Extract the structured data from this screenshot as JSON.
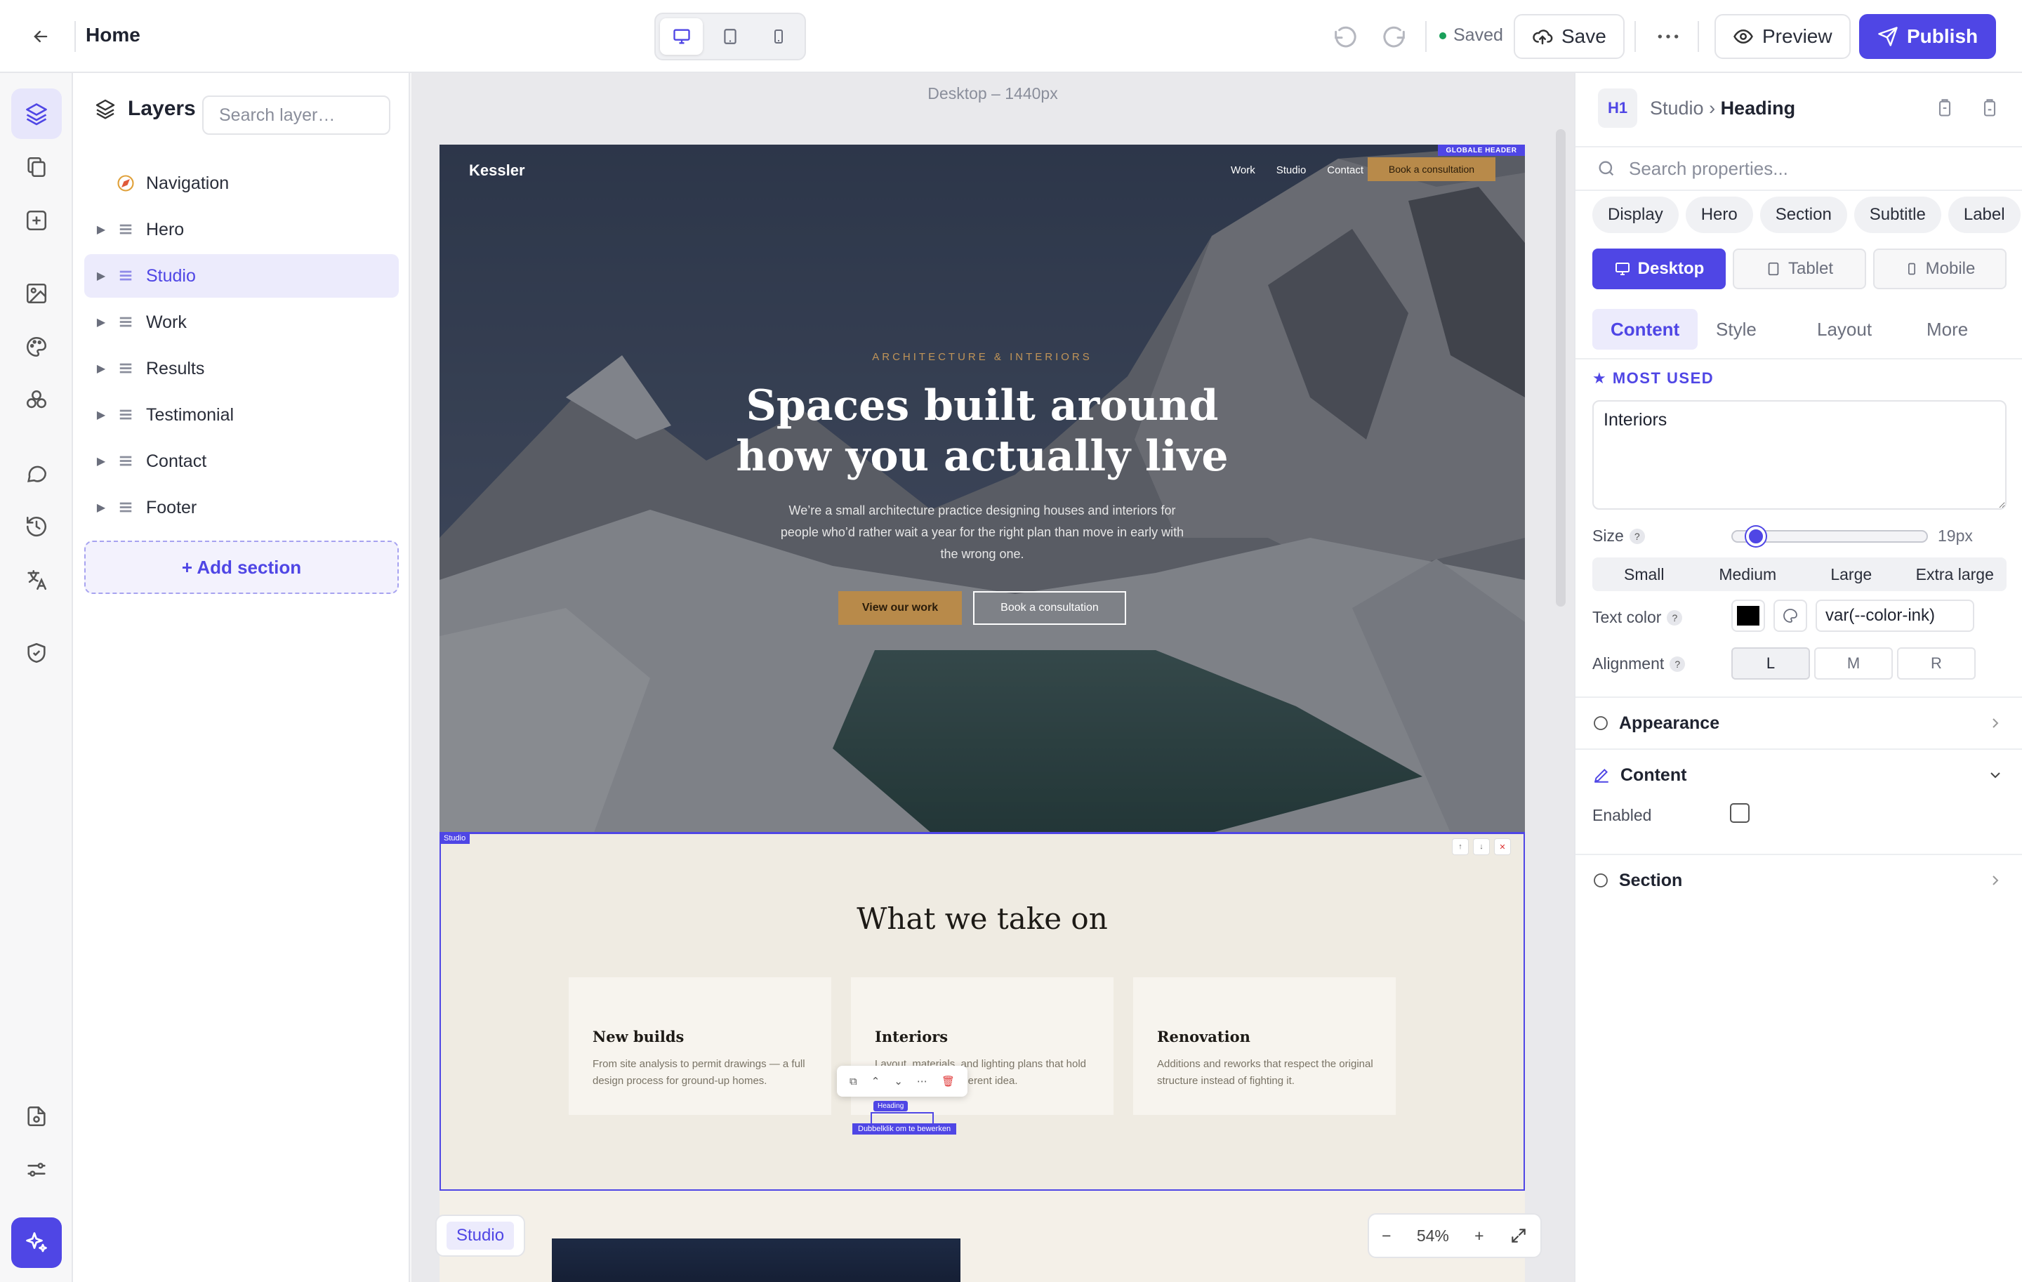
{
  "topbar": {
    "title": "Home",
    "status": "Saved",
    "save_label": "Save",
    "preview_label": "Preview",
    "publish_label": "Publish"
  },
  "layers": {
    "title": "Layers",
    "search_placeholder": "Search layer…",
    "items": [
      {
        "label": "Navigation"
      },
      {
        "label": "Hero"
      },
      {
        "label": "Studio"
      },
      {
        "label": "Work"
      },
      {
        "label": "Results"
      },
      {
        "label": "Testimonial"
      },
      {
        "label": "Contact"
      },
      {
        "label": "Footer"
      }
    ],
    "add_section": "+ Add section"
  },
  "canvas": {
    "label": "Desktop – 1440px",
    "zoom": "54%",
    "bottom_tag": "Studio",
    "site": {
      "logo": "Kessler",
      "nav": [
        "Work",
        "Studio",
        "Contact"
      ],
      "nav_cta": "Book a consultation",
      "global_badge": "GLOBALE HEADER",
      "eyebrow": "ARCHITECTURE & INTERIORS",
      "headline": "Spaces built around how you actually live",
      "subtext": "We’re a small architecture practice designing houses and interiors for people who’d rather wait a year for the right plan than move in early with the wrong one.",
      "btn_primary": "View our work",
      "btn_secondary": "Book a consultation",
      "studio_tag": "Studio",
      "section_heading": "What we take on",
      "cards": [
        {
          "title": "New builds",
          "text": "From site analysis to permit drawings — a full design process for ground-up homes."
        },
        {
          "title": "Interiors",
          "text": "Layout, materials, and lighting plans that hold together as one coherent idea."
        },
        {
          "title": "Renovation",
          "text": "Additions and reworks that respect the original structure instead of fighting it."
        }
      ],
      "heading_tag": "Heading",
      "edit_hint": "Dubbelklik om te bewerken"
    }
  },
  "props": {
    "badge": "H1",
    "crumb_parent": "Studio",
    "crumb_current": "Heading",
    "search_placeholder": "Search properties...",
    "chips": [
      "Display",
      "Hero",
      "Section",
      "Subtitle",
      "Label"
    ],
    "devices": [
      "Desktop",
      "Tablet",
      "Mobile"
    ],
    "tabs": [
      "Content",
      "Style",
      "Layout",
      "More"
    ],
    "most_used": "MOST USED",
    "text_value": "Interiors",
    "size_label": "Size",
    "size_value": "19px",
    "size_level": 0.06,
    "size_options": [
      "Small",
      "Medium",
      "Large",
      "Extra large"
    ],
    "text_color_label": "Text color",
    "text_color_value": "var(--color-ink)",
    "text_color_hex": "#000000",
    "alignment_label": "Alignment",
    "alignment_options": [
      "L",
      "M",
      "R"
    ],
    "appearance": "Appearance",
    "content": "Content",
    "enabled_label": "Enabled",
    "section": "Section"
  },
  "colors": {
    "accent": "#4f46e5",
    "gold": "#b88a4a"
  }
}
